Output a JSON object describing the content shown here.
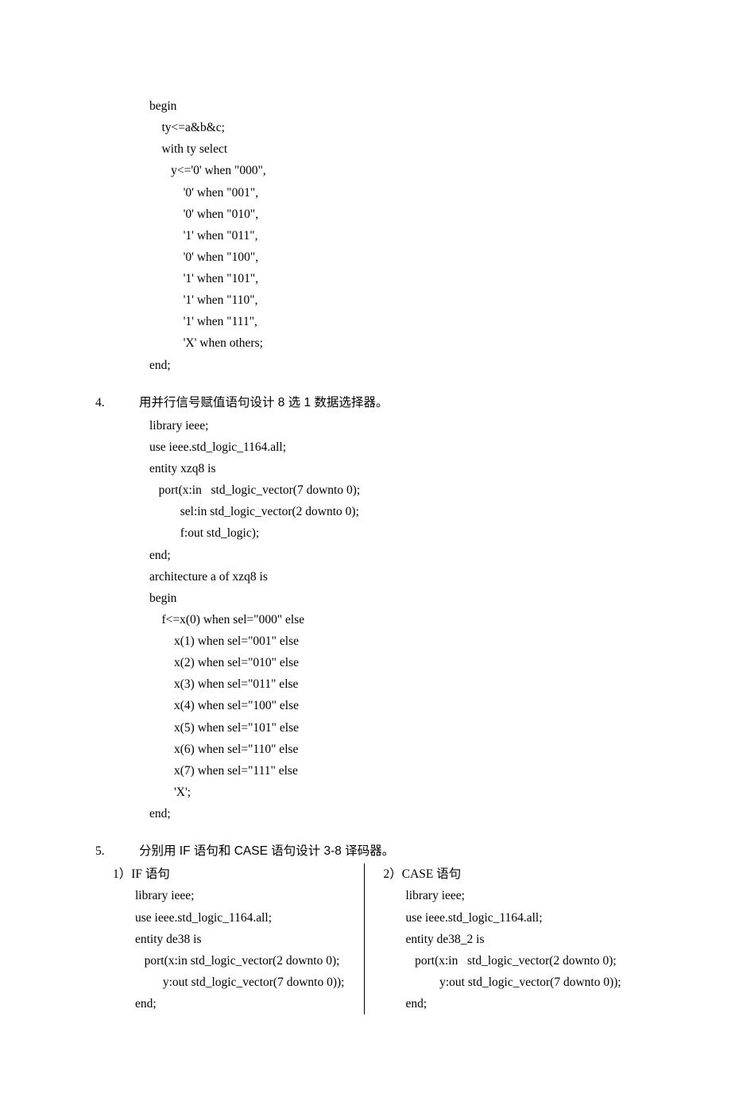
{
  "section3": {
    "code": "begin\n    ty<=a&b&c;\n    with ty select\n       y<='0' when \"000\",\n           '0' when \"001\",\n           '0' when \"010\",\n           '1' when \"011\",\n           '0' when \"100\",\n           '1' when \"101\",\n           '1' when \"110\",\n           '1' when \"111\",\n           'X' when others;\nend;"
  },
  "section4": {
    "num": "4.",
    "title": "用并行信号赋值语句设计 8 选 1 数据选择器。",
    "code": "library ieee;\nuse ieee.std_logic_1164.all;\nentity xzq8 is\n   port(x:in   std_logic_vector(7 downto 0);\n          sel:in std_logic_vector(2 downto 0);\n          f:out std_logic);\nend;\narchitecture a of xzq8 is\nbegin\n    f<=x(0) when sel=\"000\" else\n        x(1) when sel=\"001\" else\n        x(2) when sel=\"010\" else\n        x(3) when sel=\"011\" else\n        x(4) when sel=\"100\" else\n        x(5) when sel=\"101\" else\n        x(6) when sel=\"110\" else\n        x(7) when sel=\"111\" else\n        'X';\nend;"
  },
  "section5": {
    "num": "5.",
    "title": "分别用 IF 语句和 CASE 语句设计 3-8 译码器。",
    "left_label": "1）IF 语句",
    "left_code": "library ieee;\nuse ieee.std_logic_1164.all;\nentity de38 is\n   port(x:in std_logic_vector(2 downto 0);\n         y:out std_logic_vector(7 downto 0));\nend;",
    "right_label": "2）CASE 语句",
    "right_code": "library ieee;\nuse ieee.std_logic_1164.all;\nentity de38_2 is\n   port(x:in   std_logic_vector(2 downto 0);\n           y:out std_logic_vector(7 downto 0));\nend;"
  }
}
